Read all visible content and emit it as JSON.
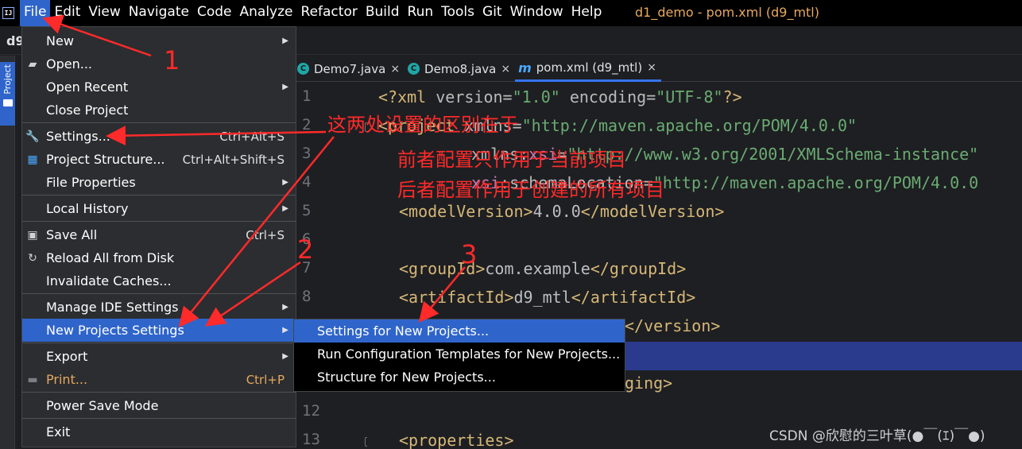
{
  "menubar": {
    "app_icon": "IJ",
    "items": [
      "File",
      "Edit",
      "View",
      "Navigate",
      "Code",
      "Analyze",
      "Refactor",
      "Build",
      "Run",
      "Tools",
      "Git",
      "Window",
      "Help"
    ],
    "active_item": "File",
    "window_title": "d1_demo - pom.xml (d9_mtl)"
  },
  "project": {
    "name": "d9",
    "tool_window_label": "Project"
  },
  "editor": {
    "tabs": [
      {
        "label": "Demo7.java",
        "icon": "java-class-icon",
        "active": false
      },
      {
        "label": "Demo8.java",
        "icon": "java-class-icon",
        "active": false
      },
      {
        "label": "pom.xml (d9_mtl)",
        "icon": "maven-icon",
        "active": true
      }
    ],
    "close_glyph": "×",
    "line_numbers": [
      "1",
      "2",
      "3",
      "4",
      "5",
      "6",
      "7",
      "8",
      "12",
      "13"
    ]
  },
  "code": {
    "l1": {
      "a": "<?xml ",
      "b": "version",
      "c": "=",
      "d": "\"1.0\"",
      "e": " encoding",
      "f": "=",
      "g": "\"UTF-8\"",
      "h": "?>"
    },
    "l2": {
      "a": "<project ",
      "b": "xmlns",
      "c": "=",
      "d": "\"http://maven.apache.org/POM/4.0.0\""
    },
    "l3": {
      "a": "xmlns",
      "b": ":",
      "c": "xsi",
      "d": "=",
      "e": "\"http://www.w3.org/2001/XMLSchema-instance\""
    },
    "l4": {
      "a": "xsi",
      "b": ":schemaLocation",
      "c": "=",
      "d": "\"http://maven.apache.org/POM/4.0.0"
    },
    "l5": {
      "a": "<modelVersion>",
      "b": "4.0.0",
      "c": "</modelVersion>"
    },
    "l7": {
      "a": "<groupId>",
      "b": "com.example",
      "c": "</groupId>"
    },
    "l8": {
      "a": "<artifactId>",
      "b": "d9_mtl",
      "c": "</artifactId>"
    },
    "l9": {
      "a": "</version>"
    },
    "l11": {
      "a": "ging>"
    },
    "l13": {
      "a": "<properties>"
    }
  },
  "file_menu": {
    "items": {
      "new": {
        "label": "New",
        "icon": ""
      },
      "open": {
        "label": "Open...",
        "icon": "folder-open-icon"
      },
      "open_recent": {
        "label": "Open Recent"
      },
      "close_project": {
        "label": "Close Project"
      },
      "settings": {
        "label": "Settings...",
        "shortcut": "Ctrl+Alt+S",
        "icon": "wrench-icon"
      },
      "project_structure": {
        "label": "Project Structure...",
        "shortcut": "Ctrl+Alt+Shift+S",
        "icon": "project-structure-icon"
      },
      "file_properties": {
        "label": "File Properties"
      },
      "local_history": {
        "label": "Local History"
      },
      "save_all": {
        "label": "Save All",
        "shortcut": "Ctrl+S",
        "icon": "save-icon"
      },
      "reload": {
        "label": "Reload All from Disk",
        "icon": "reload-icon"
      },
      "invalidate": {
        "label": "Invalidate Caches..."
      },
      "manage_ide": {
        "label": "Manage IDE Settings"
      },
      "new_projects_settings": {
        "label": "New Projects Settings"
      },
      "export": {
        "label": "Export"
      },
      "print": {
        "label": "Print...",
        "shortcut": "Ctrl+P",
        "icon": "printer-icon"
      },
      "power_save": {
        "label": "Power Save Mode"
      },
      "exit": {
        "label": "Exit"
      }
    }
  },
  "submenu": {
    "items": [
      "Settings for New Projects...",
      "Run Configuration Templates for New Projects...",
      "Structure for New Projects..."
    ]
  },
  "annotations": {
    "num1": "1",
    "num2": "2",
    "num3": "3",
    "note_line1": "这两处设置的区别在于",
    "note_line2": "前者配置只作用于当前项目",
    "note_line3": "后者配置作用于创建的所有项目",
    "color": "#ff2a2a"
  },
  "watermark": "CSDN @欣慰的三叶草(●￣(ｴ)￣●)"
}
